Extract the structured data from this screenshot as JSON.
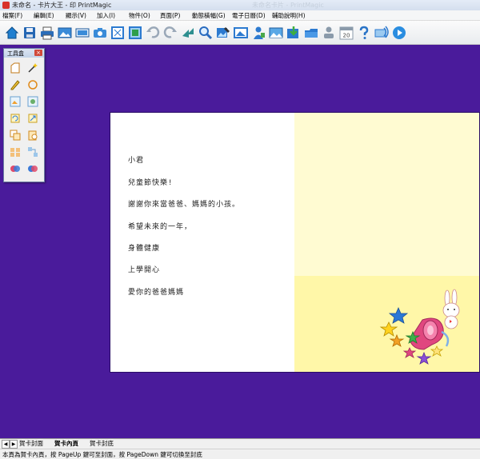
{
  "window": {
    "title": "未命名 - 卡片大王 - 印 PrintMagic",
    "faded_title": "未命名卡片 - PrintMagic"
  },
  "menu": [
    {
      "label": "檔案(F)"
    },
    {
      "label": "編輯(E)"
    },
    {
      "label": "顯示(V)"
    },
    {
      "label": "加入(I)"
    },
    {
      "label": "物件(O)"
    },
    {
      "label": "頁面(P)"
    },
    {
      "label": "動態橫幅(G)"
    },
    {
      "label": "電子日曆(D)"
    },
    {
      "label": "輔助說明(H)"
    }
  ],
  "toolbar": [
    {
      "icon": "home-icon",
      "color": "#1f7fd0"
    },
    {
      "icon": "save-icon",
      "color": "#2366b3"
    },
    {
      "icon": "print-icon",
      "color": "#2b6db9"
    },
    {
      "icon": "picture-icon",
      "color": "#3a8bd8"
    },
    {
      "icon": "text-box-icon",
      "color": "#3a8bd8"
    },
    {
      "icon": "camera-icon",
      "color": "#3a8bd8"
    },
    {
      "icon": "frame-icon",
      "color": "#2c7ad0"
    },
    {
      "icon": "frame-color-icon",
      "color": "#2c7ad0"
    },
    {
      "icon": "undo-icon",
      "color": "#9aa8b8"
    },
    {
      "icon": "redo-icon",
      "color": "#9aa8b8"
    },
    {
      "icon": "arrow-icon",
      "color": "#2d8f8f"
    },
    {
      "icon": "zoom-icon",
      "color": "#2a6bbf"
    },
    {
      "icon": "image-edit-icon",
      "color": "#2c7ad0"
    },
    {
      "icon": "photo-icon",
      "color": "#2c7ad0"
    },
    {
      "icon": "person-icon",
      "color": "#2c7ad0"
    },
    {
      "icon": "landscape-icon",
      "color": "#2c7ad0"
    },
    {
      "icon": "import-icon",
      "color": "#2c7ad0"
    },
    {
      "icon": "folder-icon",
      "color": "#2c7ad0"
    },
    {
      "icon": "user-icon",
      "color": "#8a9aaa"
    },
    {
      "icon": "calendar-icon",
      "color": "#8a9aaa",
      "text": "20"
    },
    {
      "icon": "help-icon",
      "color": "#2a74c7"
    },
    {
      "icon": "internet-icon",
      "color": "#2c7ad0"
    },
    {
      "icon": "play-icon",
      "color": "#2a8de0"
    }
  ],
  "toolbox": {
    "title": "工具盒",
    "close": "×",
    "tools": [
      {
        "icon": "new-page-tool-icon"
      },
      {
        "icon": "magic-wand-tool-icon"
      },
      {
        "icon": "pencil-tool-icon"
      },
      {
        "icon": "circle-tool-icon"
      },
      {
        "icon": "image-tool-icon"
      },
      {
        "icon": "image-effect-tool-icon"
      },
      {
        "icon": "rotate-tool-icon"
      },
      {
        "icon": "resize-tool-icon"
      },
      {
        "icon": "copy-tool-icon"
      },
      {
        "icon": "paste-tool-icon"
      },
      {
        "icon": "align-tool-icon"
      },
      {
        "icon": "group-tool-icon"
      },
      {
        "icon": "color-tool-icon"
      },
      {
        "icon": "fill-tool-icon"
      }
    ]
  },
  "card": {
    "lines": [
      {
        "text": "小君"
      },
      {
        "text": "兒童節快樂!"
      },
      {
        "text": "謝謝你來當爸爸、媽媽的小孩。"
      },
      {
        "text": "希望未來的一年，"
      },
      {
        "text": "身體健康"
      },
      {
        "text": "上學開心"
      },
      {
        "text": "愛你的爸爸媽媽"
      }
    ]
  },
  "tabs": [
    {
      "label": "賀卡封面"
    },
    {
      "label": "賀卡內頁"
    },
    {
      "label": "賀卡封底"
    }
  ],
  "status": {
    "text": "本頁為賀卡內頁，按 PageUp 鍵可至封面，按 PageDown 鍵可切換至封底"
  }
}
